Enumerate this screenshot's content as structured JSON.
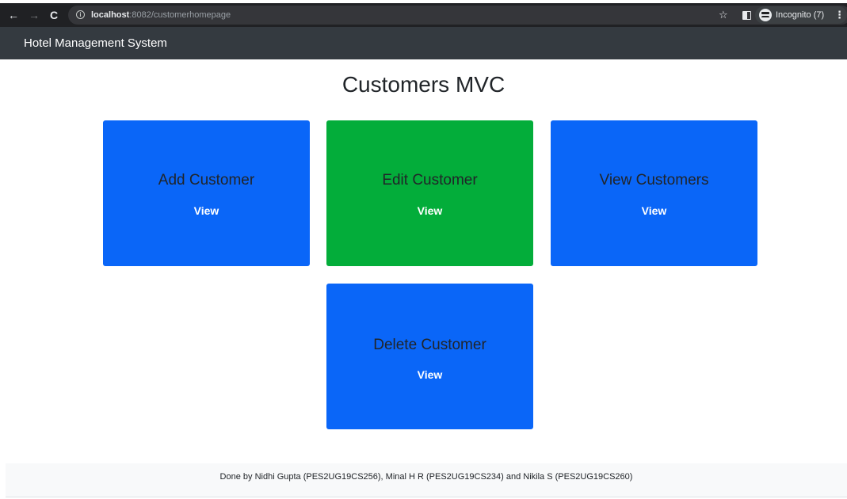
{
  "browser": {
    "url_host": "localhost",
    "url_path": ":8082/customerhomepage",
    "profile_label": "Incognito (7)",
    "icons": {
      "back": "arrow-left-icon",
      "forward": "arrow-right-icon",
      "reload": "reload-icon",
      "info": "info-icon",
      "bookmark": "star-icon",
      "side_panel": "side-panel-icon",
      "incognito": "incognito-icon",
      "menu": "kebab-menu-icon"
    }
  },
  "navbar": {
    "brand": "Hotel Management System",
    "background": "#343a40"
  },
  "page": {
    "title": "Customers MVC"
  },
  "cards": [
    {
      "title": "Add Customer",
      "link_label": "View",
      "color": "#0a66f8"
    },
    {
      "title": "Edit Customer",
      "link_label": "View",
      "color": "#03ad3a"
    },
    {
      "title": "View Customers",
      "link_label": "View",
      "color": "#0a66f8"
    },
    {
      "title": "Delete Customer",
      "link_label": "View",
      "color": "#0a66f8"
    }
  ],
  "footer": {
    "text": "Done by Nidhi Gupta (PES2UG19CS256), Minal H R (PES2UG19CS234) and Nikila S (PES2UG19CS260)"
  }
}
